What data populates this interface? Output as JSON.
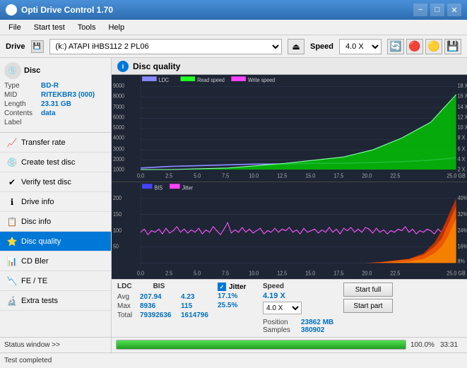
{
  "titlebar": {
    "title": "Opti Drive Control 1.70",
    "min_label": "−",
    "max_label": "□",
    "close_label": "✕"
  },
  "menubar": {
    "items": [
      "File",
      "Start test",
      "Tools",
      "Help"
    ]
  },
  "drivebar": {
    "drive_label": "Drive",
    "drive_value": "(k:)  ATAPI iHBS112  2 PL06",
    "speed_label": "Speed",
    "speed_value": "4.0 X"
  },
  "disc": {
    "label": "Disc",
    "type_label": "Type",
    "type_value": "BD-R",
    "mid_label": "MID",
    "mid_value": "RITEKBR3 (000)",
    "length_label": "Length",
    "length_value": "23.31 GB",
    "contents_label": "Contents",
    "contents_value": "data",
    "label_label": "Label",
    "label_value": ""
  },
  "sidebar": {
    "items": [
      {
        "id": "transfer-rate",
        "label": "Transfer rate",
        "icon": "📈"
      },
      {
        "id": "create-test-disc",
        "label": "Create test disc",
        "icon": "💿"
      },
      {
        "id": "verify-test-disc",
        "label": "Verify test disc",
        "icon": "✔"
      },
      {
        "id": "drive-info",
        "label": "Drive info",
        "icon": "ℹ"
      },
      {
        "id": "disc-info",
        "label": "Disc info",
        "icon": "📋"
      },
      {
        "id": "disc-quality",
        "label": "Disc quality",
        "icon": "⭐"
      },
      {
        "id": "cd-bler",
        "label": "CD Bler",
        "icon": "📊"
      },
      {
        "id": "fe-te",
        "label": "FE / TE",
        "icon": "📉"
      },
      {
        "id": "extra-tests",
        "label": "Extra tests",
        "icon": "🔬"
      }
    ],
    "active": "disc-quality"
  },
  "chart": {
    "title": "Disc quality",
    "legend": {
      "ldc": "LDC",
      "read_speed": "Read speed",
      "write_speed": "Write speed"
    },
    "legend2": {
      "bis": "BIS",
      "jitter": "Jitter"
    },
    "top_y_max": 9000,
    "top_y_labels": [
      "9000",
      "8000",
      "7000",
      "6000",
      "5000",
      "4000",
      "3000",
      "2000",
      "1000"
    ],
    "top_y_right": [
      "18 X",
      "16 X",
      "14 X",
      "12 X",
      "10 X",
      "8 X",
      "6 X",
      "4 X",
      "2 X"
    ],
    "bot_y_max": 200,
    "bot_y_labels": [
      "200",
      "150",
      "100",
      "50"
    ],
    "bot_y_right": [
      "40%",
      "32%",
      "24%",
      "16%",
      "8%"
    ],
    "x_labels": [
      "0.0",
      "2.5",
      "5.0",
      "7.5",
      "10.0",
      "12.5",
      "15.0",
      "17.5",
      "20.0",
      "22.5",
      "25.0 GB"
    ]
  },
  "stats": {
    "headers": [
      "LDC",
      "BIS"
    ],
    "jitter_header": "Jitter",
    "speed_header": "Speed",
    "speed_value": "4.19 X",
    "speed_select": "4.0 X",
    "position_label": "Position",
    "position_value": "23862 MB",
    "samples_label": "Samples",
    "samples_value": "380902",
    "rows": [
      {
        "label": "Avg",
        "ldc": "207.94",
        "bis": "4.23",
        "jitter": "17.1%"
      },
      {
        "label": "Max",
        "ldc": "8936",
        "bis": "115",
        "jitter": "25.5%"
      },
      {
        "label": "Total",
        "ldc": "79392636",
        "bis": "1614796",
        "jitter": ""
      }
    ],
    "btn_start_full": "Start full",
    "btn_start_part": "Start part"
  },
  "statusbar": {
    "status_window_label": "Status window >>",
    "test_completed_label": "Test completed",
    "progress_pct": "100.0%",
    "progress_width": 100,
    "time": "33:31"
  }
}
